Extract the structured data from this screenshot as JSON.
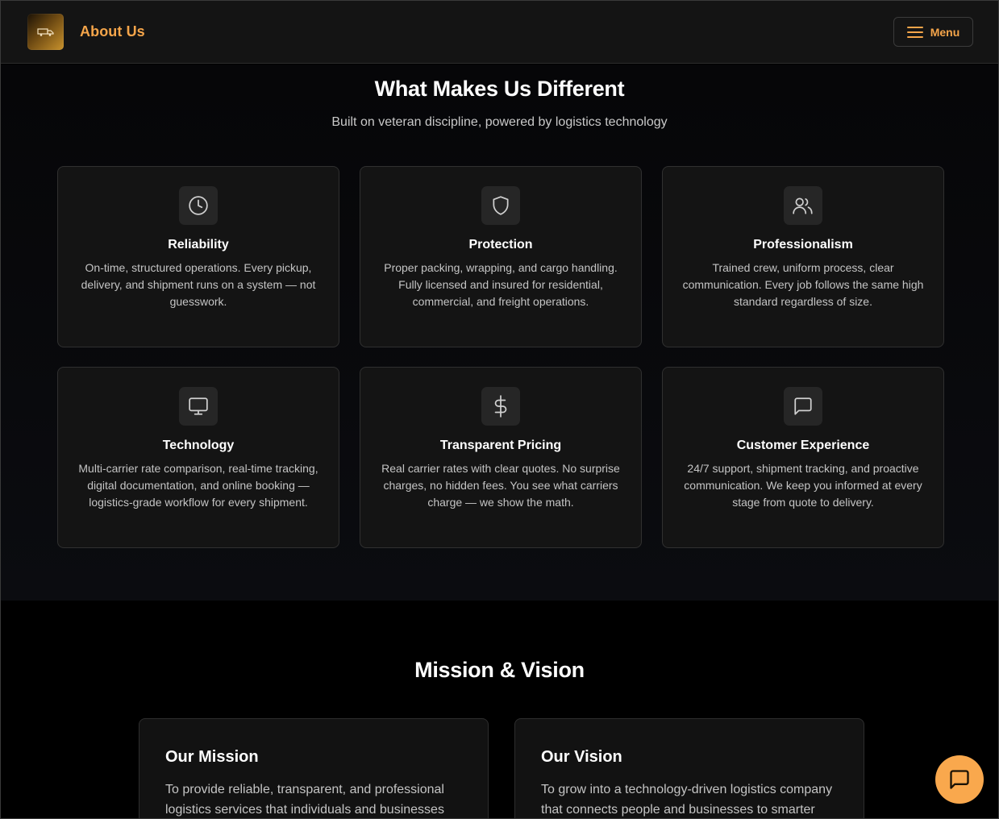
{
  "header": {
    "title": "About Us",
    "menu_label": "Menu"
  },
  "different": {
    "title": "What Makes Us Different",
    "subtitle": "Built on veteran discipline, powered by logistics technology",
    "cards": [
      {
        "icon": "clock-icon",
        "title": "Reliability",
        "text": "On-time, structured operations. Every pickup, delivery, and shipment runs on a system — not guesswork."
      },
      {
        "icon": "shield-icon",
        "title": "Protection",
        "text": "Proper packing, wrapping, and cargo handling. Fully licensed and insured for residential, commercial, and freight operations."
      },
      {
        "icon": "users-icon",
        "title": "Professionalism",
        "text": "Trained crew, uniform process, clear communication. Every job follows the same high standard regardless of size."
      },
      {
        "icon": "monitor-icon",
        "title": "Technology",
        "text": "Multi-carrier rate comparison, real-time tracking, digital documentation, and online booking — logistics-grade workflow for every shipment."
      },
      {
        "icon": "dollar-icon",
        "title": "Transparent Pricing",
        "text": "Real carrier rates with clear quotes. No surprise charges, no hidden fees. You see what carriers charge — we show the math."
      },
      {
        "icon": "chat-icon",
        "title": "Customer Experience",
        "text": "24/7 support, shipment tracking, and proactive communication. We keep you informed at every stage from quote to delivery."
      }
    ]
  },
  "mission_vision": {
    "title": "Mission & Vision",
    "mission": {
      "title": "Our Mission",
      "text": "To provide reliable, transparent, and professional logistics services that individuals and businesses"
    },
    "vision": {
      "title": "Our Vision",
      "text": "To grow into a technology-driven logistics company that connects people and businesses to smarter"
    }
  },
  "colors": {
    "accent": "#f5a54a",
    "fab": "#f9a84d",
    "card_bg": "#141414",
    "page_bg": "#000000"
  }
}
